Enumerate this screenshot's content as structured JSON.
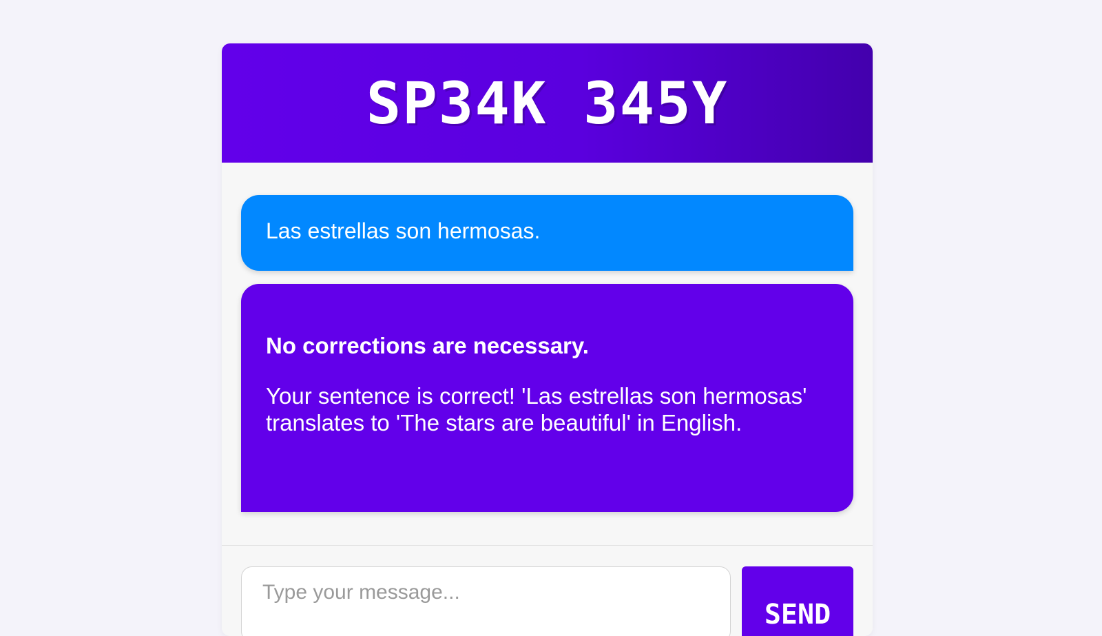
{
  "header": {
    "title": "SP34K 345Y"
  },
  "messages": {
    "user_message": "Las estrellas son hermosas.",
    "bot_heading": "No corrections are necessary.",
    "bot_body": "Your sentence is correct! 'Las estrellas son hermosas' translates to 'The stars are beautiful' in English."
  },
  "composer": {
    "placeholder": "Type your message...",
    "value": "",
    "send_label": "SEND"
  },
  "colors": {
    "page_background": "#f4f3fa",
    "header_gradient_start": "#6200ea",
    "header_gradient_end": "#4300ad",
    "user_bubble": "#0288ff",
    "bot_bubble": "#6200ea",
    "send_button": "#6200ea"
  }
}
